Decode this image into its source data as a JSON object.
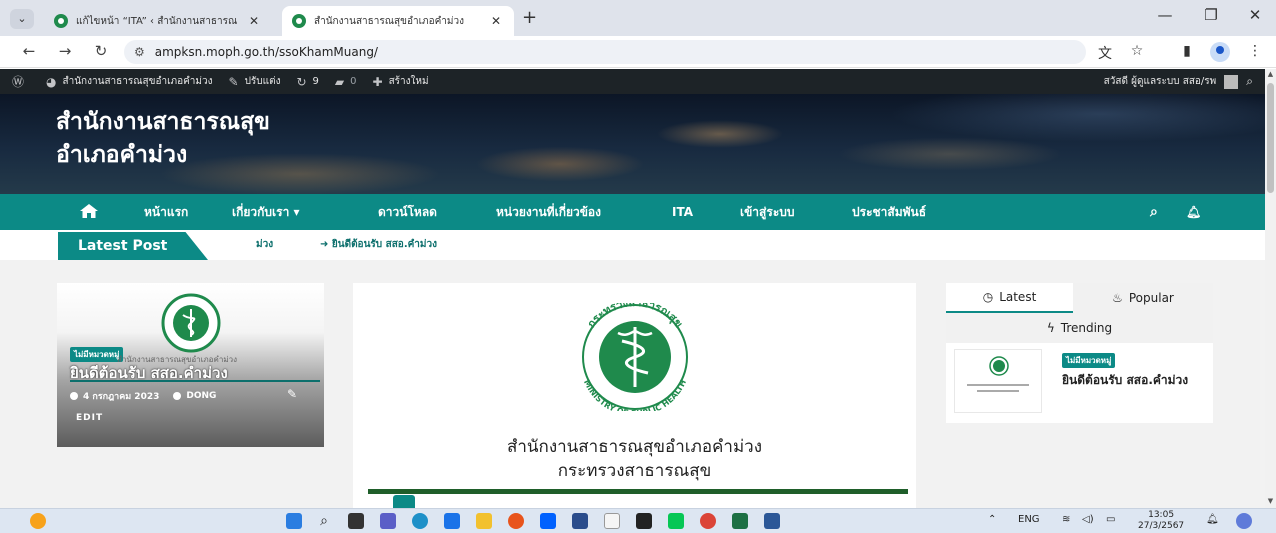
{
  "browser": {
    "tabs": [
      {
        "title": "แก้ไขหน้า “ITA” ‹ สำนักงานสาธารณ",
        "active": false
      },
      {
        "title": "สำนักงานสาธารณสุขอำเภอคำม่วง",
        "active": true
      }
    ],
    "url": "ampksn.moph.go.th/ssoKhamMuang/"
  },
  "adminbar": {
    "site_name": "สำนักงานสาธารณสุขอำเภอคำม่วง",
    "customize": "ปรับแต่ง",
    "updates_count": "9",
    "comments_count": "0",
    "new_label": "สร้างใหม่",
    "greeting": "สวัสดี ผู้ดูแลระบบ สสอ/รพ"
  },
  "header": {
    "title_line1": "สำนักงานสาธารณสุข",
    "title_line2": "อำเภอคำม่วง"
  },
  "nav": {
    "items": [
      "หน้าแรก",
      "เกี่ยวกับเรา ▾",
      "ดาวน์โหลด",
      "หน่วยงานที่เกี่ยวข้อง",
      "ITA",
      "เข้าสู่ระบบ",
      "ประชาสัมพันธ์"
    ]
  },
  "latest": {
    "label": "Latest Post",
    "ticker_fragment": "ม่วง",
    "ticker_item": "ยินดีต้อนรับ สสอ.คำม่วง"
  },
  "featured": {
    "category": "ไม่มีหมวดหมู่",
    "caption": "สำนักงานสาธารณสุขอำเภอคำม่วง",
    "title": "ยินดีต้อนรับ สสอ.คำม่วง",
    "date": "4 กรกฎาคม 2023",
    "author": "DONG",
    "edit": "EDIT"
  },
  "main_post": {
    "org_line1": "สำนักงานสาธารณสุขอำเภอคำม่วง",
    "org_line2": "กระทรวงสาธารณสุข",
    "logo_ring_top": "กระทรวงสาธารณสุข",
    "logo_ring_bottom": "MINISTRY OF PUBLIC HEALTH"
  },
  "sidebar": {
    "tabs": [
      "Latest",
      "Popular",
      "Trending"
    ],
    "post_category": "ไม่มีหมวดหมู่",
    "post_title": "ยินดีต้อนรับ สสอ.คำม่วง"
  },
  "taskbar": {
    "lang": "ENG",
    "time": "13:05",
    "date": "27/3/2567"
  },
  "colors": {
    "teal": "#0c8a86",
    "admin_bar": "#1d2327",
    "logo_green": "#1f8a4c"
  }
}
